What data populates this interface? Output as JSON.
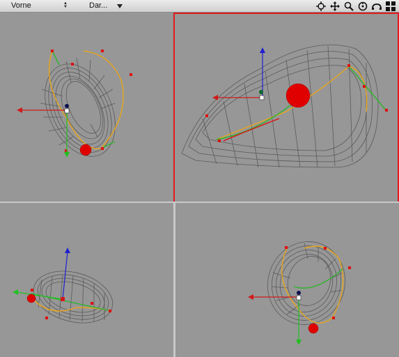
{
  "toolbar": {
    "view_select": "Vorne",
    "display_select": "Dar...",
    "tools": [
      "target-icon",
      "move-icon",
      "zoom-icon",
      "rotate-icon",
      "camera-icon",
      "layout-icon"
    ]
  },
  "viewports": {
    "active": "top-right"
  },
  "colors": {
    "active_border": "#e01a1a",
    "wire": "#5a5a5a",
    "spline": "#f2a21a",
    "sphere": "#e00000"
  }
}
